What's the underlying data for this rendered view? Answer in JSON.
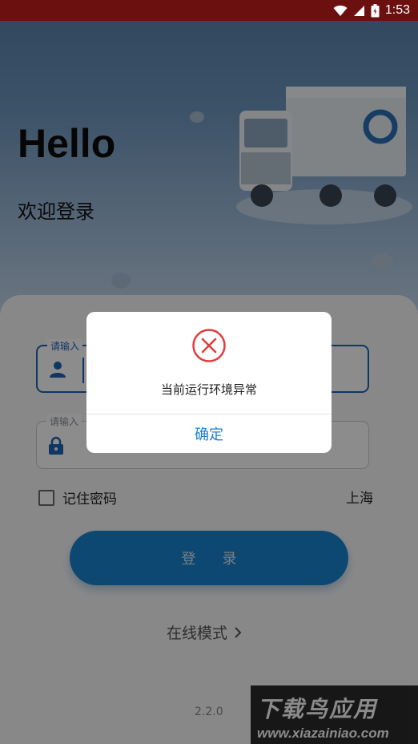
{
  "status_bar": {
    "time": "1:53"
  },
  "hero": {
    "title": "Hello",
    "subtitle": "欢迎登录"
  },
  "form": {
    "username_label": "请输入",
    "password_label": "请输入",
    "remember_label": "记住密码",
    "city": "上海",
    "login_button": "登 录",
    "online_mode": "在线模式",
    "version": "2.2.0"
  },
  "dialog": {
    "message": "当前运行环境异常",
    "confirm": "确定"
  },
  "watermark": {
    "title": "下载鸟应用",
    "url": "www.xiazainiao.com"
  },
  "colors": {
    "status_bar": "#6b0f0f",
    "primary_blue": "#1e63b4",
    "login_button": "#1783cf",
    "error_red": "#e23b3b",
    "dialog_button": "#1e7fd6"
  },
  "icons": [
    "wifi-icon",
    "signal-icon",
    "battery-icon",
    "user-icon",
    "lock-icon",
    "error-circle-icon",
    "chevron-right-icon"
  ]
}
